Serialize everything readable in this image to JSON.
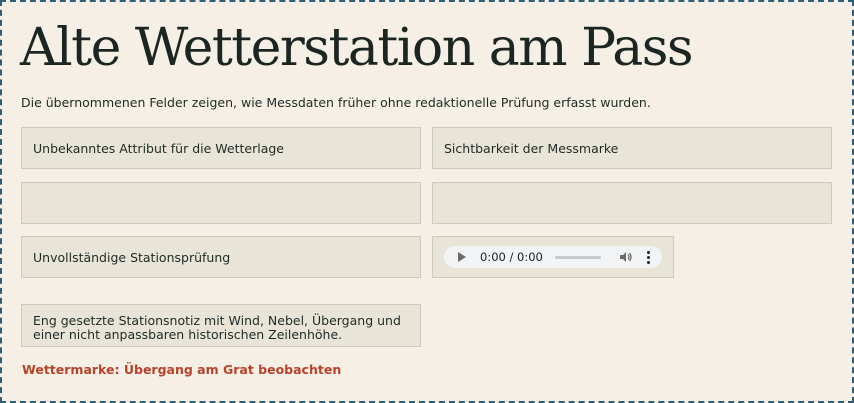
{
  "page": {
    "title": "Alte Wetterstation am Pass",
    "intro": "Die übernommenen Felder zeigen, wie Messdaten früher ohne redaktionelle Prüfung erfasst wurden."
  },
  "fields": {
    "weather_attribute": "Unbekanntes Attribut für die Wetterlage",
    "visibility": "Sichtbarkeit der Messmarke",
    "empty_left": "",
    "empty_right": "",
    "station_check": "Unvollständige Stationsprüfung",
    "station_note": "Eng gesetzte Stationsnotiz mit Wind, Nebel, Übergang und einer nicht anpassbaren historischen Zeilenhöhe."
  },
  "audio": {
    "time": "0:00 / 0:00",
    "play_icon": "play-icon",
    "volume_icon": "volume-icon",
    "menu_icon": "more-vert-icon"
  },
  "weather_mark": "Wettermarke: Übergang am Grat beobachten",
  "colors": {
    "background": "#f5efe5",
    "field_bg": "#e9e4d8",
    "border_dashed": "#2f5f78",
    "accent_red": "#b8432a"
  }
}
